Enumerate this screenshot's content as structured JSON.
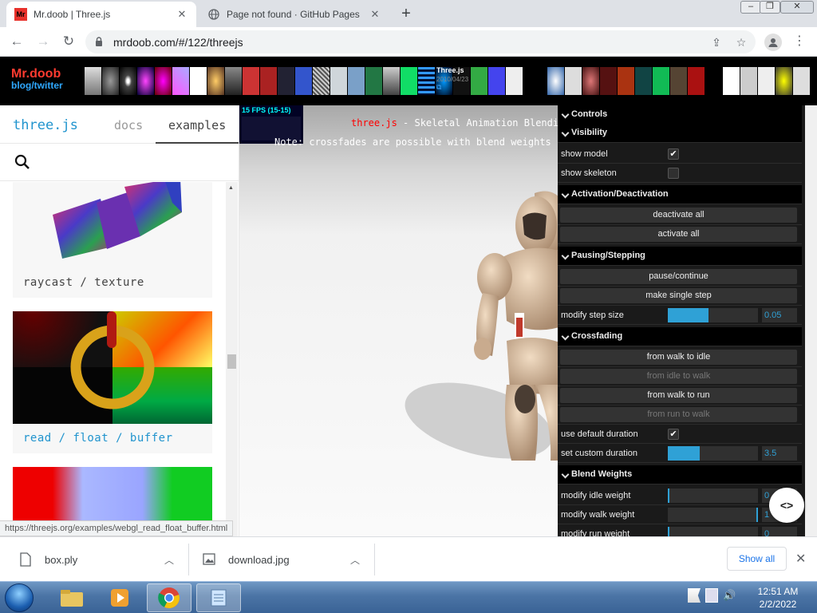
{
  "browser": {
    "tabs": [
      {
        "title": "Mr.doob | Three.js",
        "favicon": "Mr"
      },
      {
        "title": "Page not found · GitHub Pages"
      }
    ],
    "url": "mrdoob.com/#/122/threejs"
  },
  "banner": {
    "brand_line1": "Mr.doob",
    "brand_line2": "blog/twitter",
    "project_title": "Three.js",
    "project_date": "2010/04/23"
  },
  "sidebar": {
    "logo": "three.js",
    "tab_docs": "docs",
    "tab_examples": "examples",
    "cards": [
      {
        "label": "raycast / texture"
      },
      {
        "label": "read / float / buffer"
      }
    ],
    "status_url": "https://threejs.org/examples/webgl_read_float_buffer.html"
  },
  "viewport": {
    "fps": "15 FPS (15-15)",
    "info_brand": "three.js",
    "info_rest": " - Skeletal Animation Blendi",
    "info_line2": "Note: crossfades are possible with blend weights b"
  },
  "gui": {
    "controls": "Controls",
    "visibility": "Visibility",
    "show_model": "show model",
    "show_skeleton": "show skeleton",
    "activation": "Activation/Deactivation",
    "deactivate_all": "deactivate all",
    "activate_all": "activate all",
    "pausing": "Pausing/Stepping",
    "pause_continue": "pause/continue",
    "single_step": "make single step",
    "step_size_label": "modify step size",
    "step_size_value": "0.05",
    "step_size_fraction": 0.45,
    "crossfading": "Crossfading",
    "walk_to_idle": "from walk to idle",
    "idle_to_walk": "from idle to walk",
    "walk_to_run": "from walk to run",
    "run_to_walk": "from run to walk",
    "default_duration": "use default duration",
    "custom_duration_label": "set custom duration",
    "custom_duration_value": "3.5",
    "custom_duration_fraction": 0.35,
    "blend_weights": "Blend Weights",
    "idle_weight": "modify idle weight",
    "idle_weight_value": "0",
    "walk_weight": "modify walk weight",
    "walk_weight_value": "1",
    "run_weight": "modify run weight",
    "run_weight_value": "0"
  },
  "downloads": {
    "items": [
      {
        "name": "box.ply"
      },
      {
        "name": "download.jpg"
      }
    ],
    "show_all": "Show all"
  },
  "taskbar": {
    "time": "12:51 AM",
    "date": "2/2/2022"
  },
  "colors": {
    "threejs_blue": "#2194ce",
    "gui_slider": "#2fa1d6",
    "brand_red": "#ff3b30"
  }
}
